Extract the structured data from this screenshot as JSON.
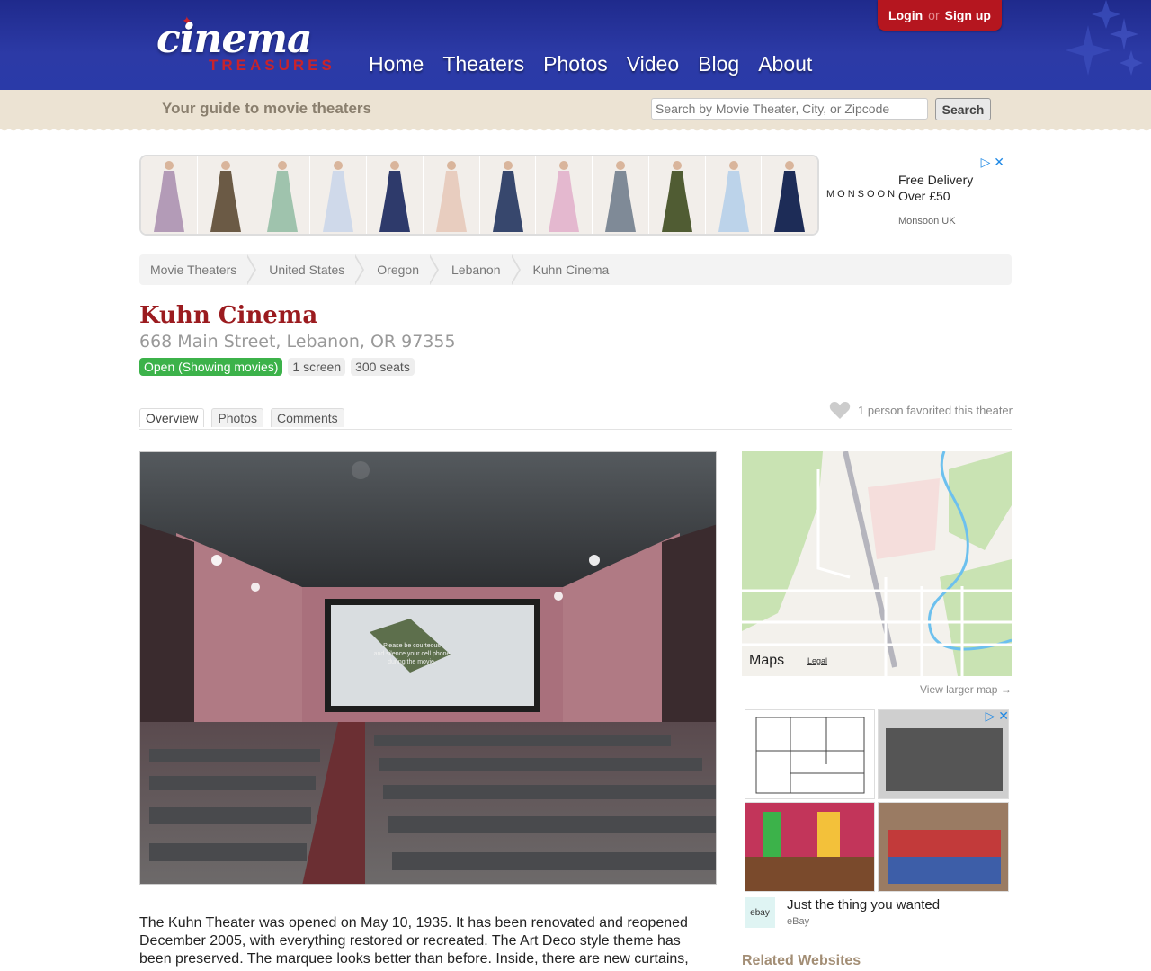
{
  "header": {
    "logo_main": "cinema",
    "logo_sub": "TREASURES",
    "nav": [
      "Home",
      "Theaters",
      "Photos",
      "Video",
      "Blog",
      "About"
    ],
    "login": "Login",
    "or": "or",
    "signup": "Sign up"
  },
  "strip": {
    "tagline": "Your guide to movie theaters",
    "search_placeholder": "Search by Movie Theater, City, or Zipcode",
    "search_button": "Search"
  },
  "top_ad": {
    "brand": "MONSOON",
    "line1": "Free Delivery",
    "line2": "Over £50",
    "source": "Monsoon UK",
    "dress_colors": [
      "#b39bb7",
      "#6b5a45",
      "#9fc3ad",
      "#cfd9ea",
      "#2e3a6b",
      "#e8cdbf",
      "#37476d",
      "#e4b8cf",
      "#7f8a97",
      "#505c33",
      "#bcd3ea",
      "#1d2c57"
    ]
  },
  "breadcrumb": [
    "Movie Theaters",
    "United States",
    "Oregon",
    "Lebanon",
    "Kuhn Cinema"
  ],
  "theater": {
    "name": "Kuhn Cinema",
    "address": "668 Main Street, Lebanon, OR 97355",
    "status": "Open (Showing movies)",
    "screens": "1 screen",
    "seats": "300 seats",
    "status_color": "#3cb24a"
  },
  "tabs": [
    "Overview",
    "Photos",
    "Comments"
  ],
  "favorites": "1 person favorited this theater",
  "description": "The Kuhn Theater was opened on May 10, 1935. It has been renovated and reopened December 2005, with everything restored or recreated. The Art Deco style theme has been preserved. The marquee looks better than before. Inside, there are new curtains,",
  "map": {
    "logo": "Maps",
    "legal": "Legal",
    "larger_link": "View larger map →"
  },
  "side_ad": {
    "title": "Just the thing you wanted",
    "source": "eBay",
    "logo_text": "ebay"
  },
  "related": "Related Websites",
  "screen_text": [
    "Please be courteous",
    "and silence your cell phone",
    "during the movie."
  ]
}
